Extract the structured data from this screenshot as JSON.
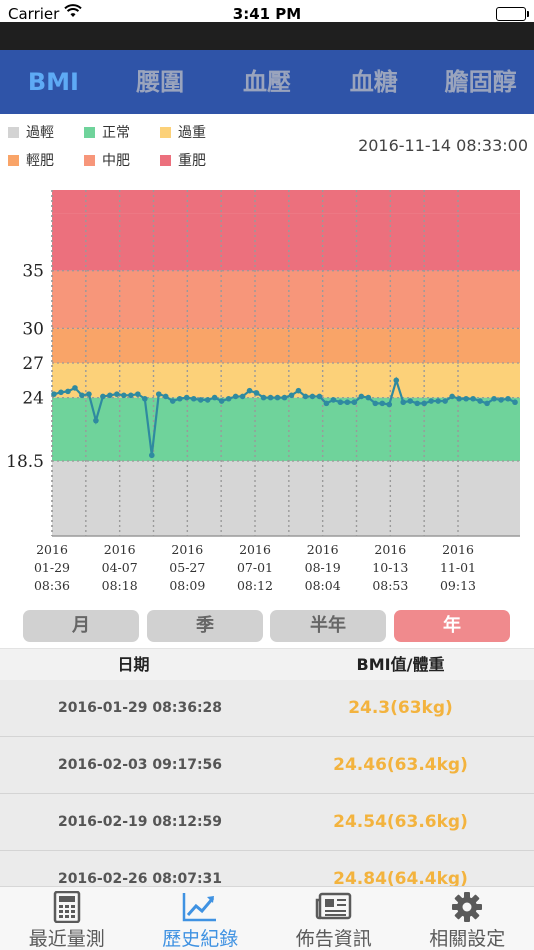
{
  "status_bar": {
    "carrier": "Carrier",
    "time": "3:41 PM"
  },
  "top_tabs": [
    {
      "label": "BMI",
      "active": true
    },
    {
      "label": "腰圍",
      "active": false
    },
    {
      "label": "血壓",
      "active": false
    },
    {
      "label": "血糖",
      "active": false
    },
    {
      "label": "膽固醇",
      "active": false
    }
  ],
  "legend": {
    "items": [
      {
        "label": "過輕",
        "color": "#d3d3d3"
      },
      {
        "label": "正常",
        "color": "#6fd39b"
      },
      {
        "label": "過重",
        "color": "#fcd179"
      },
      {
        "label": "輕肥",
        "color": "#f9a468"
      },
      {
        "label": "中肥",
        "color": "#f7967a"
      },
      {
        "label": "重肥",
        "color": "#ec707d"
      }
    ],
    "timestamp": "2016-11-14 08:33:00"
  },
  "chart_data": {
    "type": "line",
    "ylim": [
      12,
      42
    ],
    "bands": [
      {
        "from": 12,
        "to": 18.5,
        "color": "#d6d6d6"
      },
      {
        "from": 18.5,
        "to": 24,
        "color": "#6fd39b"
      },
      {
        "from": 24,
        "to": 27,
        "color": "#fcd179"
      },
      {
        "from": 27,
        "to": 30,
        "color": "#f9a468"
      },
      {
        "from": 30,
        "to": 35,
        "color": "#f7967a"
      },
      {
        "from": 35,
        "to": 40,
        "color": "#ec707d"
      }
    ],
    "y_ticks": [
      "35",
      "30",
      "27",
      "24",
      "18.5"
    ],
    "x_tick_labels": [
      {
        "year": "2016",
        "date": "01-29",
        "time": "08:36"
      },
      {
        "year": "2016",
        "date": "04-07",
        "time": "08:18"
      },
      {
        "year": "2016",
        "date": "05-27",
        "time": "08:09"
      },
      {
        "year": "2016",
        "date": "07-01",
        "time": "08:12"
      },
      {
        "year": "2016",
        "date": "08-19",
        "time": "08:04"
      },
      {
        "year": "2016",
        "date": "10-13",
        "time": "08:53"
      },
      {
        "year": "2016",
        "date": "11-01",
        "time": "09:13"
      }
    ],
    "line_color": "#2f8aa0",
    "series": [
      {
        "values": [
          24.3,
          24.46,
          24.54,
          24.84,
          24.2,
          24.3,
          22.0,
          24.1,
          24.2,
          24.3,
          24.2,
          24.2,
          24.3,
          23.9,
          19.0,
          24.3,
          24.1,
          23.7,
          23.9,
          24.0,
          23.9,
          23.8,
          23.8,
          24.0,
          23.7,
          23.9,
          24.1,
          24.1,
          24.6,
          24.4,
          24.0,
          24.0,
          24.0,
          24.0,
          24.2,
          24.6,
          24.1,
          24.1,
          24.1,
          23.5,
          23.8,
          23.6,
          23.6,
          23.6,
          24.1,
          24.0,
          23.5,
          23.5,
          23.4,
          25.5,
          23.6,
          23.7,
          23.5,
          23.5,
          23.7,
          23.7,
          23.7,
          24.1,
          23.9,
          23.9,
          23.9,
          23.7,
          23.5,
          23.9,
          23.8,
          23.9,
          23.6
        ]
      }
    ]
  },
  "period_buttons": [
    {
      "label": "月",
      "active": false
    },
    {
      "label": "季",
      "active": false
    },
    {
      "label": "半年",
      "active": false
    },
    {
      "label": "年",
      "active": true
    }
  ],
  "table": {
    "headers": [
      "日期",
      "BMI值/體重"
    ],
    "rows": [
      {
        "date": "2016-01-29 08:36:28",
        "value": "24.3(63kg)"
      },
      {
        "date": "2016-02-03 09:17:56",
        "value": "24.46(63.4kg)"
      },
      {
        "date": "2016-02-19 08:12:59",
        "value": "24.54(63.6kg)"
      },
      {
        "date": "2016-02-26 08:07:31",
        "value": "24.84(64.4kg)"
      }
    ]
  },
  "bottom_tabs": [
    {
      "label": "最近量測",
      "icon": "calculator-icon",
      "active": false
    },
    {
      "label": "歷史紀錄",
      "icon": "trend-chart-icon",
      "active": true
    },
    {
      "label": "佈告資訊",
      "icon": "newspaper-icon",
      "active": false
    },
    {
      "label": "相關設定",
      "icon": "gear-icon",
      "active": false
    }
  ],
  "colors": {
    "header_blue": "#2f54a8",
    "active_tab_blue": "#5eaaf5",
    "value_orange": "#f3b33e",
    "active_period": "#f08a8d"
  }
}
